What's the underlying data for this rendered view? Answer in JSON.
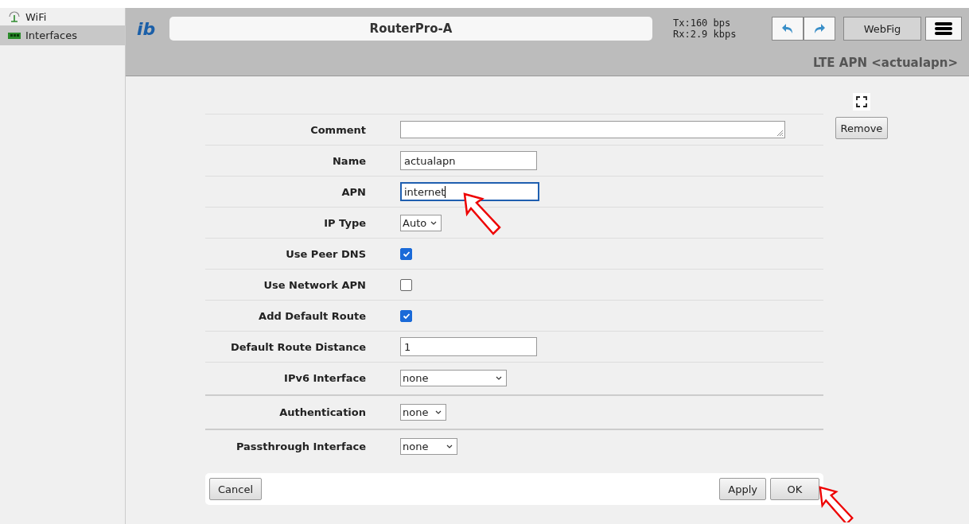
{
  "sidebar": {
    "items": [
      {
        "label": "WiFi",
        "selected": false
      },
      {
        "label": "Interfaces",
        "selected": true
      }
    ]
  },
  "header": {
    "logo": "ib",
    "device": "RouterPro-A",
    "traffic": [
      "Tx:160 bps",
      "Rx:2.9 kbps"
    ],
    "mode_button": "WebFig",
    "page_title": "LTE APN <actualapn>"
  },
  "sections": [
    [
      {
        "label": "Comment",
        "kind": "textarea"
      },
      {
        "label": "Name",
        "kind": "text",
        "value": "actualapn",
        "focused": false
      },
      {
        "label": "APN",
        "kind": "text",
        "value": "internet",
        "focused": true
      },
      {
        "label": "IP Type",
        "kind": "select",
        "value": "Auto"
      },
      {
        "label": "Use Peer DNS",
        "kind": "checkbox",
        "checked": true
      },
      {
        "label": "Use Network APN",
        "kind": "checkbox",
        "checked": false
      },
      {
        "label": "Add Default Route",
        "kind": "checkbox",
        "checked": true
      },
      {
        "label": "Default Route Distance",
        "kind": "text",
        "value": "1",
        "focused": false
      },
      {
        "label": "IPv6 Interface",
        "kind": "select",
        "value": "none"
      }
    ],
    [
      {
        "label": "Authentication",
        "kind": "select",
        "value": "none"
      }
    ],
    [
      {
        "label": "Passthrough Interface",
        "kind": "select",
        "value": "none"
      }
    ]
  ],
  "side_buttons": [
    "Remove"
  ],
  "footer": {
    "left": [
      "Cancel"
    ],
    "right": [
      "Apply",
      "OK"
    ]
  }
}
